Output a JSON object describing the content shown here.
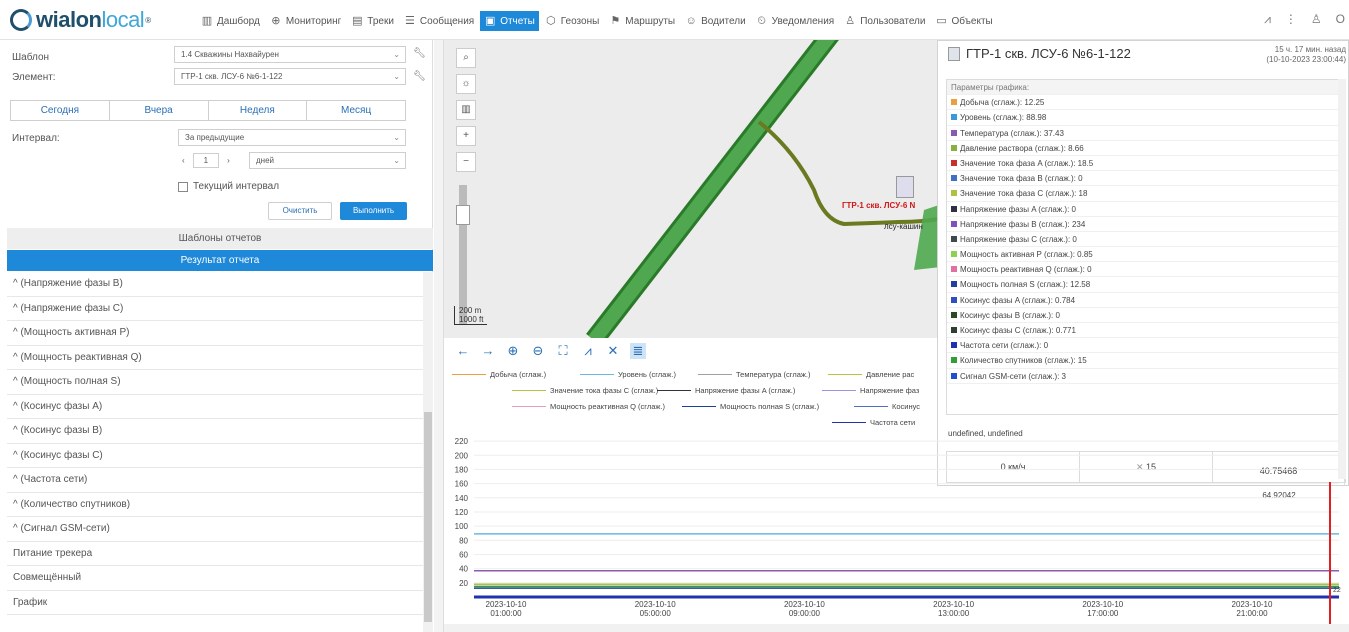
{
  "brand": {
    "part1": "wialon",
    "part2": "local",
    "mark": "®"
  },
  "nav": [
    {
      "label": "Дашборд",
      "icon": "dashboard-icon",
      "glyph": "▥"
    },
    {
      "label": "Мониторинг",
      "icon": "globe-icon",
      "glyph": "⊕"
    },
    {
      "label": "Треки",
      "icon": "tracks-icon",
      "glyph": "▤"
    },
    {
      "label": "Сообщения",
      "icon": "messages-icon",
      "glyph": "☰"
    },
    {
      "label": "Отчеты",
      "icon": "reports-icon",
      "glyph": "▣",
      "active": true
    },
    {
      "label": "Геозоны",
      "icon": "geofence-icon",
      "glyph": "⬡"
    },
    {
      "label": "Маршруты",
      "icon": "route-icon",
      "glyph": "⚑"
    },
    {
      "label": "Водители",
      "icon": "driver-icon",
      "glyph": "☺"
    },
    {
      "label": "Уведомления",
      "icon": "bell-icon",
      "glyph": "⏲"
    },
    {
      "label": "Пользователи",
      "icon": "user-icon",
      "glyph": "♙"
    },
    {
      "label": "Объекты",
      "icon": "truck-icon",
      "glyph": "▭"
    }
  ],
  "topRight": {
    "user_glyph": "♙",
    "more": "⋮",
    "chart": "⩘",
    "text": "О"
  },
  "form": {
    "template_label": "Шаблон",
    "template_value": "1.4 Скважины Нахвайурен",
    "element_label": "Элемент:",
    "element_value": "ГТР-1 скв. ЛСУ-6 №6-1-122",
    "periods": [
      "Сегодня",
      "Вчера",
      "Неделя",
      "Месяц"
    ],
    "interval_label": "Интервал:",
    "interval_value": "За предыдущие",
    "count_value": "1",
    "unit_value": "дней",
    "current_interval": "Текущий интервал",
    "clear_label": "Очистить",
    "run_label": "Выполнить"
  },
  "sections": {
    "templates": "Шаблоны отчетов",
    "result": "Результат отчета"
  },
  "result_items": [
    "^ (Напряжение фазы B)",
    "^ (Напряжение фазы C)",
    "^ (Мощность активная P)",
    "^ (Мощность реактивная Q)",
    "^ (Мощность полная S)",
    "^ (Косинус фазы A)",
    "^ (Косинус фазы B)",
    "^ (Косинус фазы C)",
    "^ (Частота сети)",
    "^ (Количество спутников)",
    "^ (Сигнал GSM-сети)",
    "Питание трекера",
    "Совмещённый",
    "График"
  ],
  "map": {
    "scale_m": "200 m",
    "scale_ft": "1000 ft",
    "marker_label": "ГТР-1 скв. ЛСУ-6 N",
    "marker_sub": "лсу-кашин"
  },
  "popup": {
    "title": "ГТР-1 скв. ЛСУ-6 №6-1-122",
    "time_ago": "15 ч. 17 мин. назад",
    "time_abs": "(10-10-2023 23:00:44)",
    "params_head": "Параметры графика:",
    "params": [
      {
        "text": "Добыча (сглаж.): 12.25",
        "color": "#e8a040"
      },
      {
        "text": "Уровень (сглаж.): 88.98",
        "color": "#3a9ad9"
      },
      {
        "text": "Температура (сглаж.): 37.43",
        "color": "#8a5ab0"
      },
      {
        "text": "Давление раствора (сглаж.): 8.66",
        "color": "#8ab040"
      },
      {
        "text": "Значение тока фаза A (сглаж.): 18.5",
        "color": "#c83030"
      },
      {
        "text": "Значение тока фаза B (сглаж.): 0",
        "color": "#4070c0"
      },
      {
        "text": "Значение тока фаза C (сглаж.): 18",
        "color": "#b0c040"
      },
      {
        "text": "Напряжение фазы A (сглаж.): 0",
        "color": "#303040"
      },
      {
        "text": "Напряжение фазы B (сглаж.): 234",
        "color": "#8050c0"
      },
      {
        "text": "Напряжение фазы C (сглаж.): 0",
        "color": "#404850"
      },
      {
        "text": "Мощность активная P (сглаж.): 0.85",
        "color": "#90d050"
      },
      {
        "text": "Мощность реактивная Q (сглаж.): 0",
        "color": "#e070a0"
      },
      {
        "text": "Мощность полная S (сглаж.): 12.58",
        "color": "#2040a0"
      },
      {
        "text": "Косинус фазы A (сглаж.): 0.784",
        "color": "#3050c0"
      },
      {
        "text": "Косинус фазы B (сглаж.): 0",
        "color": "#2a4a20"
      },
      {
        "text": "Косинус фазы C (сглаж.): 0.771",
        "color": "#304030"
      },
      {
        "text": "Частота сети (сглаж.): 0",
        "color": "#2030b0"
      },
      {
        "text": "Количество спутников (сглаж.): 15",
        "color": "#30a030"
      },
      {
        "text": "Сигнал GSM-сети (сглаж.): 3",
        "color": "#2050d0"
      }
    ],
    "undefined_text": "undefined, undefined",
    "speed": "0 км/ч",
    "satellites": "15",
    "lat": "40.75468",
    "lon": "64.92042"
  },
  "chart_tools": [
    "←",
    "→",
    "⊕",
    "⊖",
    "⛶",
    "⩘",
    "✕",
    "≣"
  ],
  "chart_data": {
    "type": "line",
    "legend": [
      {
        "name": "Добыча (сглаж.)",
        "color": "#e8a040"
      },
      {
        "name": "Уровень (сглаж.)",
        "color": "#6ab8e0"
      },
      {
        "name": "Температура (сглаж.)",
        "color": "#a0a0a0"
      },
      {
        "name": "Давление рас",
        "color": "#c0c040"
      },
      {
        "name": "Значение тока фазы C (сглаж.)",
        "color": "#c0c040"
      },
      {
        "name": "Напряжение фазы A (сглаж.)",
        "color": "#303040"
      },
      {
        "name": "Напряжение фаз",
        "color": "#a090e0"
      },
      {
        "name": "Мощность реактивная Q (сглаж.)",
        "color": "#e0a0c0"
      },
      {
        "name": "Мощность полная S (сглаж.)",
        "color": "#2040a0"
      },
      {
        "name": "Косинус",
        "color": "#5070c0"
      },
      {
        "name": "Частота сети",
        "color": "#2030b0"
      }
    ],
    "y_ticks": [
      220,
      200,
      180,
      160,
      140,
      120,
      100,
      80,
      60,
      40,
      20
    ],
    "ylim": [
      0,
      230
    ],
    "x_ticks": [
      {
        "date": "2023-10-10",
        "time": "01:00:00"
      },
      {
        "date": "2023-10-10",
        "time": "05:00:00"
      },
      {
        "date": "2023-10-10",
        "time": "09:00:00"
      },
      {
        "date": "2023-10-10",
        "time": "13:00:00"
      },
      {
        "date": "2023-10-10",
        "time": "17:00:00"
      },
      {
        "date": "2023-10-10",
        "time": "21:00:00"
      }
    ],
    "series": [
      {
        "color": "#a090e0",
        "values": [
          234,
          234,
          235,
          234,
          234,
          235,
          234,
          234
        ]
      },
      {
        "color": "#6ab8e0",
        "values": [
          89,
          89,
          89,
          89,
          89,
          89,
          89,
          89
        ]
      },
      {
        "color": "#8a5ab0",
        "values": [
          37,
          37,
          37,
          37,
          37,
          37,
          37,
          37
        ]
      },
      {
        "color": "#b0c040",
        "values": [
          18,
          18,
          18,
          18,
          18,
          18,
          18,
          18
        ]
      },
      {
        "color": "#30a030",
        "values": [
          15,
          15,
          15,
          15,
          15,
          15,
          15,
          15
        ]
      },
      {
        "color": "#2040a0",
        "values": [
          12.5,
          12.5,
          12.5,
          12.5,
          12.5,
          12.5,
          12.5,
          12.5
        ]
      },
      {
        "color": "#2030b0",
        "values": [
          0,
          0,
          0,
          0,
          0,
          0,
          0,
          0
        ]
      }
    ],
    "cursor_color": "#e02020",
    "cursor_label": "22"
  }
}
